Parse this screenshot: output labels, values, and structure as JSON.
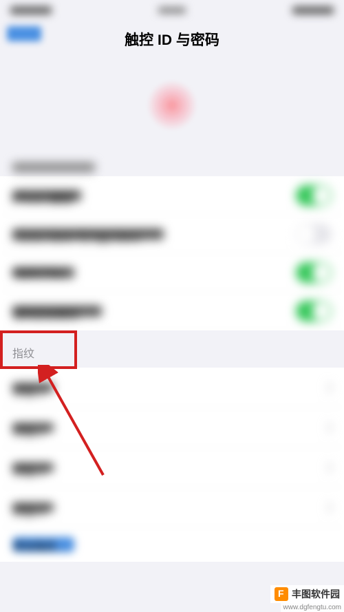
{
  "statusBar": {
    "time": "",
    "carrier": "",
    "battery": ""
  },
  "nav": {
    "back": "设置",
    "title": "触控 ID 与密码"
  },
  "uses_section": {
    "header": "将触控 ID 用于:",
    "items": [
      {
        "label": "iPhone 解锁",
        "toggle": true
      },
      {
        "label": "iTunes Store 与 App Store",
        "toggle": false
      },
      {
        "label": "Apple Pay",
        "toggle": true
      },
      {
        "label": "密码自动填充",
        "toggle": true
      }
    ]
  },
  "fingerprint_section": {
    "header": "指纹",
    "items": [
      {
        "label": "手指 1"
      },
      {
        "label": "手指 2"
      },
      {
        "label": "手指 3"
      },
      {
        "label": "手指 4"
      }
    ],
    "add": "添加指纹…"
  },
  "watermark": {
    "brand": "丰图软件园",
    "url": "www.dgfengtu.com"
  },
  "colors": {
    "highlight": "#d32020",
    "toggle_on": "#34c759",
    "link": "#4a90e2"
  }
}
